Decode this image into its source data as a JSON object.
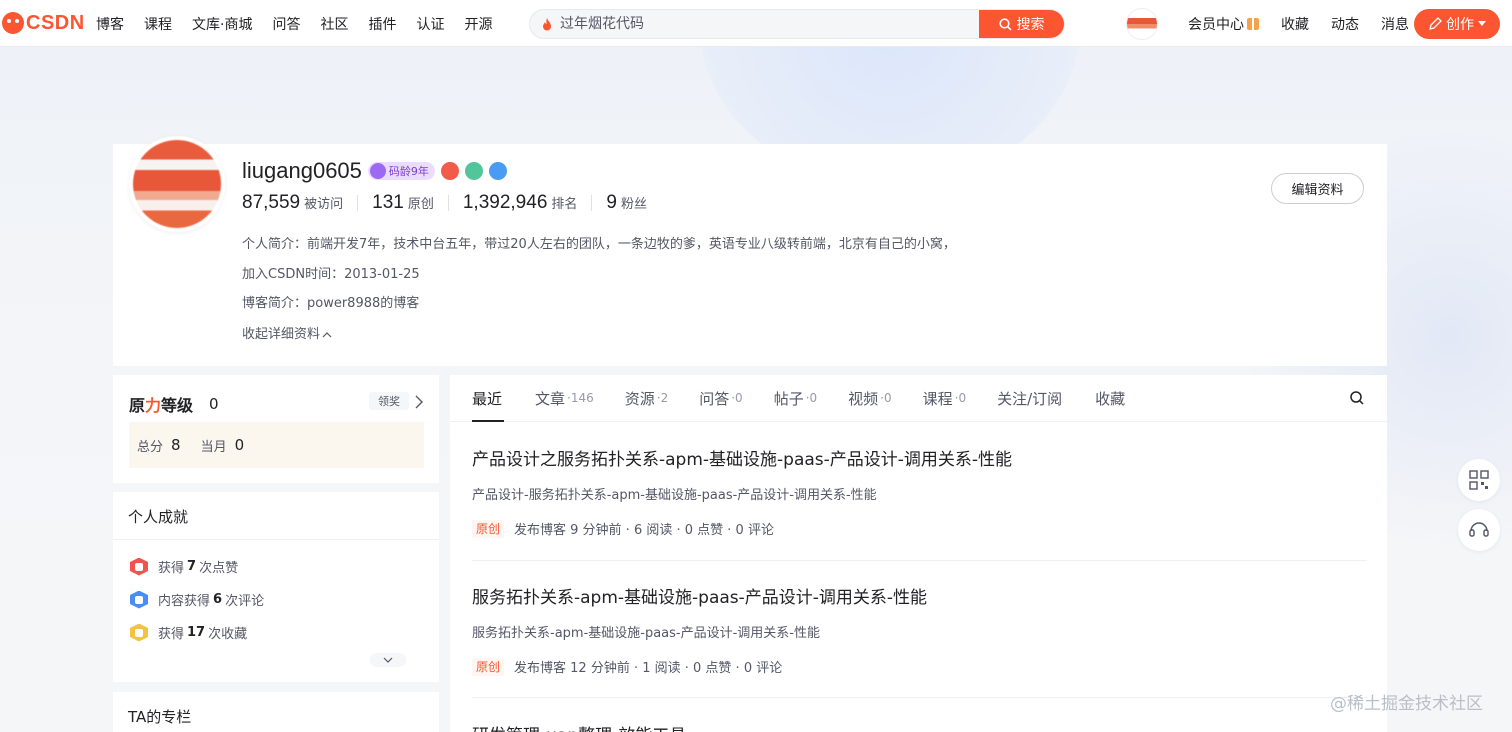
{
  "nav": {
    "logo": "CSDN",
    "links": [
      "博客",
      "课程",
      "文库·商城",
      "问答",
      "社区",
      "插件",
      "认证",
      "开源"
    ],
    "search_placeholder": "过年烟花代码",
    "search_button": "搜索",
    "right_links": [
      "会员中心",
      "收藏",
      "动态",
      "消息"
    ],
    "create_button": "创作"
  },
  "profile": {
    "username": "liugang0605",
    "code_age": "码龄9年",
    "stats": [
      {
        "num": "87,559",
        "label": "被访问"
      },
      {
        "num": "131",
        "label": "原创"
      },
      {
        "num": "1,392,946",
        "label": "排名"
      },
      {
        "num": "9",
        "label": "粉丝"
      }
    ],
    "bio": "个人简介：前端开发7年，技术中台五年，带过20人左右的团队，一条边牧的爹，英语专业八级转前端，北京有自己的小窝，",
    "join": "加入CSDN时间：2013-01-25",
    "blog": "博客简介：power8988的博客",
    "collapse": "收起详细资料",
    "edit_button": "编辑资料"
  },
  "level": {
    "title_a": "原",
    "title_b": "力",
    "title_c": "等级",
    "value": "0",
    "claim": "领奖",
    "total_label": "总分",
    "total": "8",
    "month_label": "当月",
    "month": "0"
  },
  "achieve": {
    "title": "个人成就",
    "items": [
      {
        "pre": "获得",
        "num": "7",
        "post": "次点赞",
        "color": "#f2534e"
      },
      {
        "pre": "内容获得",
        "num": "6",
        "post": "次评论",
        "color": "#4b8df8"
      },
      {
        "pre": "获得",
        "num": "17",
        "post": "次收藏",
        "color": "#f6c244"
      }
    ]
  },
  "column": {
    "title": "TA的专栏"
  },
  "tabs": [
    {
      "label": "最近",
      "count": ""
    },
    {
      "label": "文章",
      "count": "·146"
    },
    {
      "label": "资源",
      "count": "·2"
    },
    {
      "label": "问答",
      "count": "·0"
    },
    {
      "label": "帖子",
      "count": "·0"
    },
    {
      "label": "视频",
      "count": "·0"
    },
    {
      "label": "课程",
      "count": "·0"
    },
    {
      "label": "关注/订阅",
      "count": ""
    },
    {
      "label": "收藏",
      "count": ""
    }
  ],
  "articles": [
    {
      "title": "产品设计之服务拓扑关系-apm-基础设施-paas-产品设计-调用关系-性能",
      "desc": "产品设计-服务拓扑关系-apm-基础设施-paas-产品设计-调用关系-性能",
      "tag": "原创",
      "meta": "发布博客 9 分钟前 · 6 阅读 · 0 点赞 · 0 评论"
    },
    {
      "title": "服务拓扑关系-apm-基础设施-paas-产品设计-调用关系-性能",
      "desc": "服务拓扑关系-apm-基础设施-paas-产品设计-调用关系-性能",
      "tag": "原创",
      "meta": "发布博客 12 分钟前 · 1 阅读 · 0 点赞 · 0 评论"
    },
    {
      "title": "研发管理-uap整理-效能工具"
    }
  ],
  "watermark": "@稀土掘金技术社区",
  "colors": {
    "accent": "#fc5531",
    "text": "#222226",
    "muted": "#555666"
  }
}
